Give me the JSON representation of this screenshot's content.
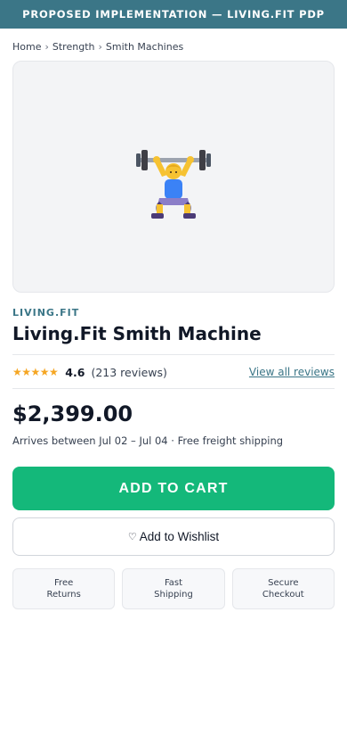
{
  "banner": {
    "text": "PROPOSED IMPLEMENTATION — LIVING.FIT PDP"
  },
  "breadcrumb": {
    "items": [
      "Home",
      "Strength",
      "Smith Machines"
    ],
    "separator": "›"
  },
  "gallery": {
    "image_icon": "weightlifter-icon"
  },
  "product": {
    "brand": "LIVING.FIT",
    "title": "Living.Fit Smith Machine",
    "rating": {
      "stars_display": "★★★★★",
      "value": "4.6",
      "reviews_text": "(213 reviews)",
      "view_all_label": "View all reviews"
    },
    "price": "$2,399.00",
    "delivery": "Arrives between Jul 02 – Jul 04 · Free freight shipping"
  },
  "actions": {
    "add_to_cart_label": "ADD TO CART",
    "wishlist_icon_glyph": "♡",
    "wishlist_label": "Add to Wishlist"
  },
  "features": [
    {
      "label": "Free\nReturns"
    },
    {
      "label": "Fast\nShipping"
    },
    {
      "label": "Secure\nCheckout"
    }
  ],
  "colors": {
    "accent_teal": "#3b7687",
    "cta_green": "#14b87a",
    "star_gold": "#f5a623"
  }
}
